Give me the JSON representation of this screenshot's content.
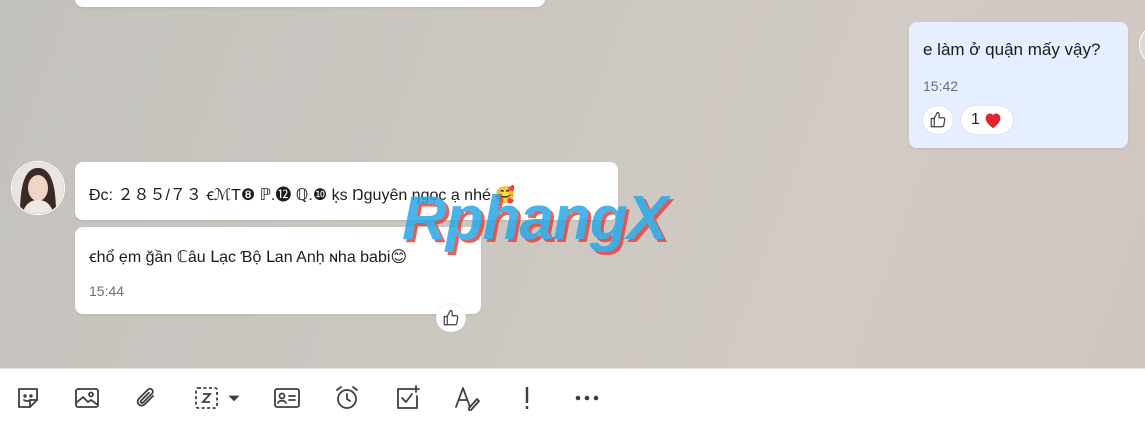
{
  "messages": {
    "sent": {
      "text": "e làm ở quận mấy vậy?",
      "time": "15:42",
      "reaction_count": "1",
      "reaction_emoji": "❤️"
    },
    "received_1": {
      "text": "Đc: ２８５/７３ ꞓℳТ❽ ℙ.⓬ ℚ.❿ ķs Ŋguyên ŋgọc ạ nhé 🥰"
    },
    "received_2": {
      "text": "ꞓhổ ẹm ğần ℂâu Ⅼạc Ɓộ Ⅼan Anḥ ɴha babi😊",
      "time": "15:44"
    }
  },
  "watermark": "RphangX",
  "colors": {
    "sent_bubble": "#e5efff",
    "received_bubble": "#ffffff",
    "heart": "#e0262e",
    "icon": "#3b3f45"
  },
  "toolbar": {
    "items": [
      "sticker-icon",
      "image-icon",
      "attachment-icon",
      "screenshot-icon",
      "contact-card-icon",
      "reminder-icon",
      "task-icon",
      "text-format-icon",
      "important-icon",
      "more-icon"
    ]
  }
}
